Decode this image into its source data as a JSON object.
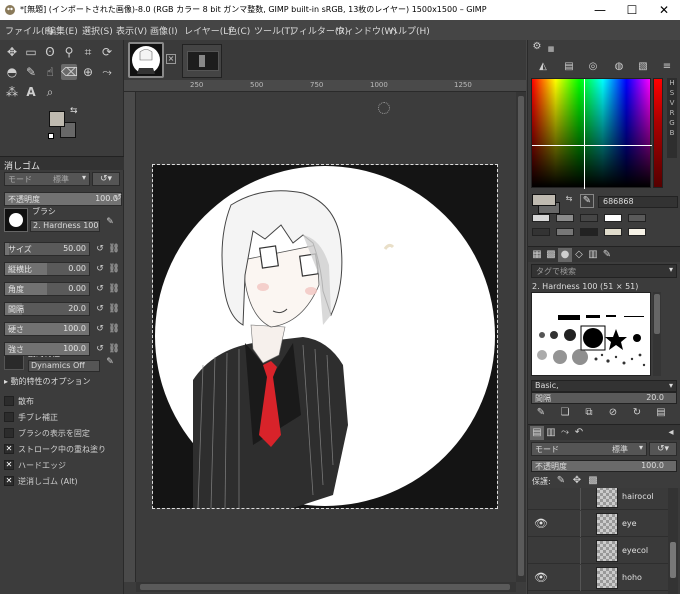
{
  "titlebar": {
    "title": "*[無題] (インポートされた画像)-8.0 (RGB カラー 8 bit ガンマ整数, GIMP built-in sRGB, 13枚のレイヤー) 1500x1500 – GIMP",
    "minimize": "—",
    "maximize": "☐",
    "close": "✕"
  },
  "menu": [
    "ファイル(F)",
    "編集(E)",
    "選択(S)",
    "表示(V)",
    "画像(I)",
    "レイヤー(L)",
    "色(C)",
    "ツール(T)",
    "フィルター(R)",
    "ウィンドウ(W)",
    "ヘルプ(H)"
  ],
  "colors": {
    "foreground": "#bfbab0",
    "background": "#686868",
    "accent": "#2b7fd3"
  },
  "tool_options": {
    "title": "消しゴム",
    "mode_label": "モード",
    "mode_value": "標準",
    "opacity_label": "不透明度",
    "opacity_value": "100.0",
    "brush_label": "ブラシ",
    "brush_name": "2. Hardness 100",
    "sliders": [
      {
        "label": "サイズ",
        "value": "50.00",
        "fraction": 0.05
      },
      {
        "label": "縦横比",
        "value": "0.00",
        "fraction": 0.5
      },
      {
        "label": "角度",
        "value": "0.00",
        "fraction": 0.5
      },
      {
        "label": "間隔",
        "value": "20.0",
        "fraction": 0.2
      },
      {
        "label": "硬さ",
        "value": "100.0",
        "fraction": 1.0
      },
      {
        "label": "強さ",
        "value": "100.0",
        "fraction": 1.0
      }
    ],
    "dynamics_label": "動的特性",
    "dynamics_value": "Dynamics Off",
    "dynamics_options": "動的特性のオプション",
    "checks": [
      {
        "label": "散布",
        "checked": false
      },
      {
        "label": "手ブレ補正",
        "checked": false
      },
      {
        "label": "ブラシの表示を固定",
        "checked": false
      },
      {
        "label": "ストローク中の重ね塗り",
        "checked": true
      },
      {
        "label": "ハードエッジ",
        "checked": true
      },
      {
        "label": "逆消しゴム (Alt)",
        "checked": true
      }
    ]
  },
  "ruler": {
    "top_ticks": [
      "250",
      "500",
      "750",
      "1000",
      "1250"
    ],
    "left_ticks": [
      "1",
      "2",
      "5",
      "7",
      "1",
      "0",
      "1",
      "2"
    ]
  },
  "color_panel": {
    "hex_value": "686868"
  },
  "brushes_panel": {
    "search_placeholder": "タグで検索",
    "brush_title": "2. Hardness 100 (51 × 51)",
    "tag_value": "Basic,",
    "spacing_label": "間隔",
    "spacing_value": "20.0"
  },
  "layers_panel": {
    "mode_label": "モード",
    "mode_value": "標準",
    "opacity_label": "不透明度",
    "opacity_value": "100.0",
    "lock_label": "保護:",
    "layers": [
      {
        "name": "hairocol",
        "visible": false
      },
      {
        "name": "eye",
        "visible": true
      },
      {
        "name": "eyecol",
        "visible": false
      },
      {
        "name": "hoho",
        "visible": true
      }
    ]
  }
}
